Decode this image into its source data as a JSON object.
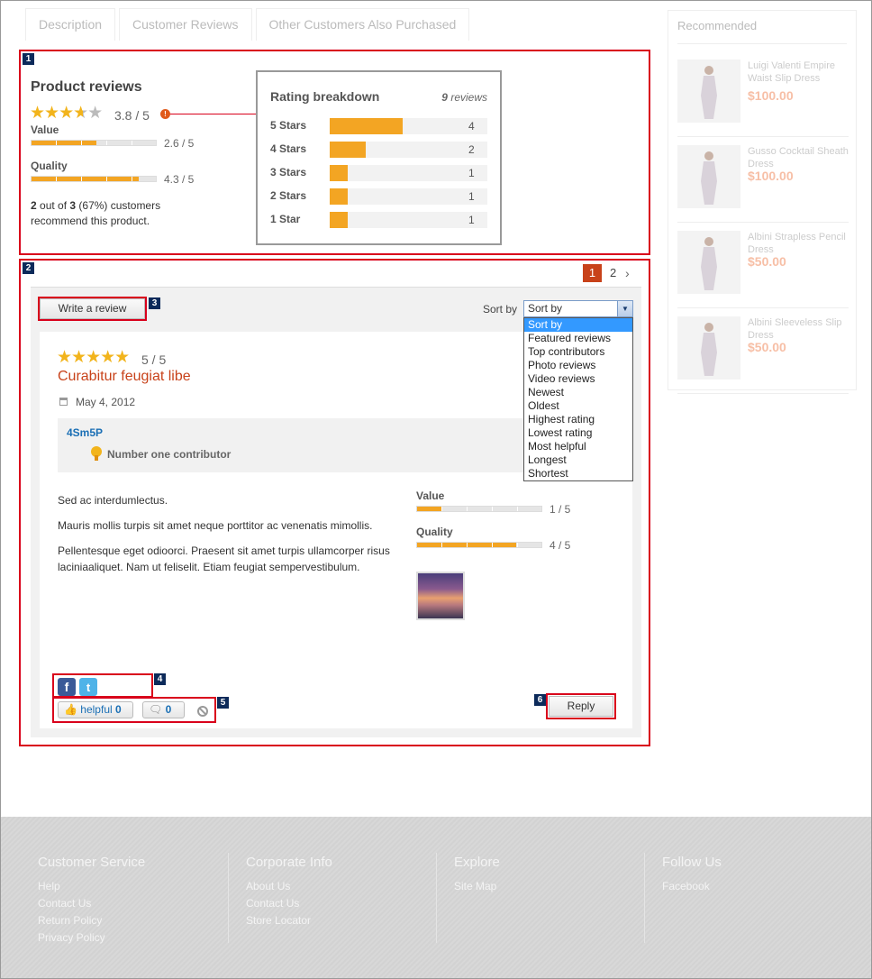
{
  "tabs": [
    "Description",
    "Customer Reviews",
    "Other Customers Also Purchased"
  ],
  "annotations": [
    "1",
    "2",
    "3",
    "4",
    "5",
    "6"
  ],
  "summary": {
    "title": "Product reviews",
    "rating_text": "3.8 / 5",
    "rating": 3.8,
    "info_icon": "info-icon",
    "value_label": "Value",
    "value_text": "2.6 / 5",
    "value": 2.6,
    "quality_label": "Quality",
    "quality_text": "4.3 / 5",
    "quality": 4.3,
    "recommend_count": "2",
    "recommend_mid": " out of ",
    "recommend_total": "3",
    "recommend_rest": " (67%) customers",
    "recommend_line2": "recommend this product."
  },
  "breakdown": {
    "title": "Rating breakdown",
    "total": "9",
    "total_suffix": " reviews",
    "rows": [
      {
        "label": "5 Stars",
        "count": "4",
        "fraction": 0.46
      },
      {
        "label": "4 Stars",
        "count": "2",
        "fraction": 0.23
      },
      {
        "label": "3 Stars",
        "count": "1",
        "fraction": 0.115
      },
      {
        "label": "2 Stars",
        "count": "1",
        "fraction": 0.115
      },
      {
        "label": "1 Star",
        "count": "1",
        "fraction": 0.115
      }
    ]
  },
  "pager": {
    "current": "1",
    "next": "2",
    "next_icon": "chevron-right-icon"
  },
  "toolbar": {
    "write_review": "Write a review",
    "sort_label": "Sort by",
    "sort_selected": "Sort by",
    "sort_options": [
      "Sort by",
      "Featured reviews",
      "Top contributors",
      "Photo reviews",
      "Video reviews",
      "Newest",
      "Oldest",
      "Highest rating",
      "Lowest rating",
      "Most helpful",
      "Longest",
      "Shortest"
    ]
  },
  "review": {
    "rating_text": "5 / 5",
    "rating": 5,
    "title": "Curabitur feugiat libe",
    "date": "May 4, 2012",
    "author": "4Sm5P",
    "badge": "Number one contributor",
    "paragraphs": [
      "Sed ac interdumlectus.",
      "Mauris mollis turpis sit amet neque porttitor ac venenatis mimollis.",
      "Pellentesque eget odioorci. Praesent sit amet turpis ullamcorper risus laciniaaliquet. Nam ut feliselit. Etiam feugiat sempervestibulum."
    ],
    "value_label": "Value",
    "value_text": "1 / 5",
    "value": 1,
    "quality_label": "Quality",
    "quality_text": "4 / 5",
    "quality": 4,
    "helpful_label": "helpful",
    "helpful_count": "0",
    "unhelpful_count": "0",
    "reply": "Reply"
  },
  "recommended": {
    "title": "Recommended",
    "items": [
      {
        "name": "Luigi Valenti Empire Waist Slip Dress",
        "price": "$100.00"
      },
      {
        "name": "Gusso Cocktail Sheath Dress",
        "price": "$100.00"
      },
      {
        "name": "Albini Strapless Pencil Dress",
        "price": "$50.00"
      },
      {
        "name": "Albini Sleeveless Slip Dress",
        "price": "$50.00"
      }
    ]
  },
  "footer": {
    "columns": [
      {
        "title": "Customer Service",
        "links": [
          "Help",
          "Contact Us",
          "Return Policy",
          "Privacy Policy"
        ]
      },
      {
        "title": "Corporate Info",
        "links": [
          "About Us",
          "Contact Us",
          "Store Locator"
        ]
      },
      {
        "title": "Explore",
        "links": [
          "Site Map"
        ]
      },
      {
        "title": "Follow Us",
        "links": [
          "Facebook"
        ]
      }
    ]
  },
  "colors": {
    "accent": "#f3a523",
    "annotation": "#d9001b",
    "title_red": "#c8421a",
    "link_blue": "#1a6fb5"
  }
}
